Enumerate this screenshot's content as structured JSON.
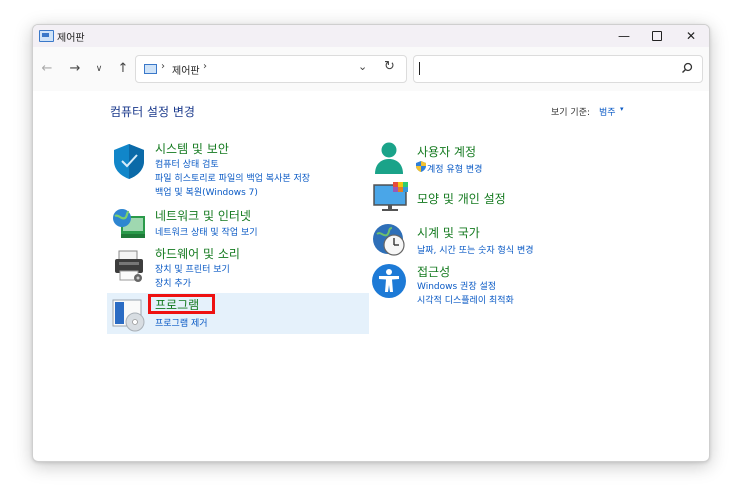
{
  "window": {
    "title": "제어판"
  },
  "controls": {
    "minimize": "—",
    "close": "✕"
  },
  "nav": {
    "back": "←",
    "forward": "→",
    "recent": "∨",
    "up": "↑",
    "breadcrumb": [
      "제어판"
    ],
    "sep": "›",
    "dropdown": "⌄",
    "refresh": "↻"
  },
  "search": {
    "value": ""
  },
  "header": {
    "title": "컴퓨터 설정 변경",
    "view_by_label": "보기 기준:",
    "view_by_value": "범주",
    "view_by_arrow": "▾"
  },
  "categories": {
    "system": {
      "title": "시스템 및 보안",
      "links": [
        "컴퓨터 상태 검토",
        "파일 히스토리로 파일의 백업 복사본 저장",
        "백업 및 복원(Windows 7)"
      ]
    },
    "network": {
      "title": "네트워크 및 인터넷",
      "links": [
        "네트워크 상태 및 작업 보기"
      ]
    },
    "hardware": {
      "title": "하드웨어 및 소리",
      "links": [
        "장치 및 프린터 보기",
        "장치 추가"
      ]
    },
    "programs": {
      "title": "프로그램",
      "links": [
        "프로그램 제거"
      ]
    },
    "accounts": {
      "title": "사용자 계정",
      "links": [
        "계정 유형 변경"
      ]
    },
    "appearance": {
      "title": "모양 및 개인 설정",
      "links": []
    },
    "clock": {
      "title": "시계 및 국가",
      "links": [
        "날짜, 시간 또는 숫자 형식 변경"
      ]
    },
    "ease": {
      "title": "접근성",
      "links": [
        "Windows 권장 설정",
        "시각적 디스플레이 최적화"
      ]
    }
  },
  "colors": {
    "category_title": "#147a1f",
    "link": "#0a5ac5",
    "highlight": "#e5f1fb",
    "red_box": "#ee1111"
  }
}
